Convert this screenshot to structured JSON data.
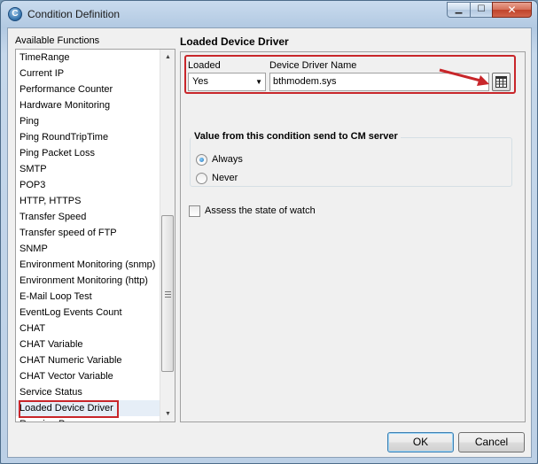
{
  "window": {
    "title": "Condition Definition",
    "icon": "app-logo-icon",
    "icon_glyph": "C",
    "controls": {
      "minimize": "minimize-icon",
      "maximize": "maximize-icon",
      "close": "close-icon"
    }
  },
  "left_panel": {
    "label": "Available Functions",
    "items": [
      "TimeRange",
      "Current IP",
      "Performance Counter",
      "Hardware Monitoring",
      "Ping",
      "Ping RoundTripTime",
      "Ping Packet Loss",
      "SMTP",
      "POP3",
      "HTTP, HTTPS",
      "Transfer Speed",
      "Transfer speed of FTP",
      "SNMP",
      "Environment Monitoring (snmp)",
      "Environment Monitoring (http)",
      "E-Mail Loop Test",
      "EventLog Events Count",
      "CHAT",
      "CHAT Variable",
      "CHAT Numeric Variable",
      "CHAT Vector Variable",
      "Service Status",
      "Loaded Device Driver",
      "Running Process"
    ],
    "selected_index": 22
  },
  "right_panel": {
    "title": "Loaded Device Driver",
    "loaded_label": "Loaded",
    "loaded_value": "Yes",
    "driver_label": "Device Driver Name",
    "driver_value": "bthmodem.sys",
    "group_title": "Value from this condition send to CM server",
    "radio_always": "Always",
    "radio_never": "Never",
    "radio_selected": "Always",
    "checkbox_label": "Assess the state of watch",
    "checkbox_checked": false
  },
  "buttons": {
    "ok": "OK",
    "cancel": "Cancel"
  },
  "colors": {
    "annotation_red": "#c8262a",
    "selection": "#e6eef7"
  }
}
